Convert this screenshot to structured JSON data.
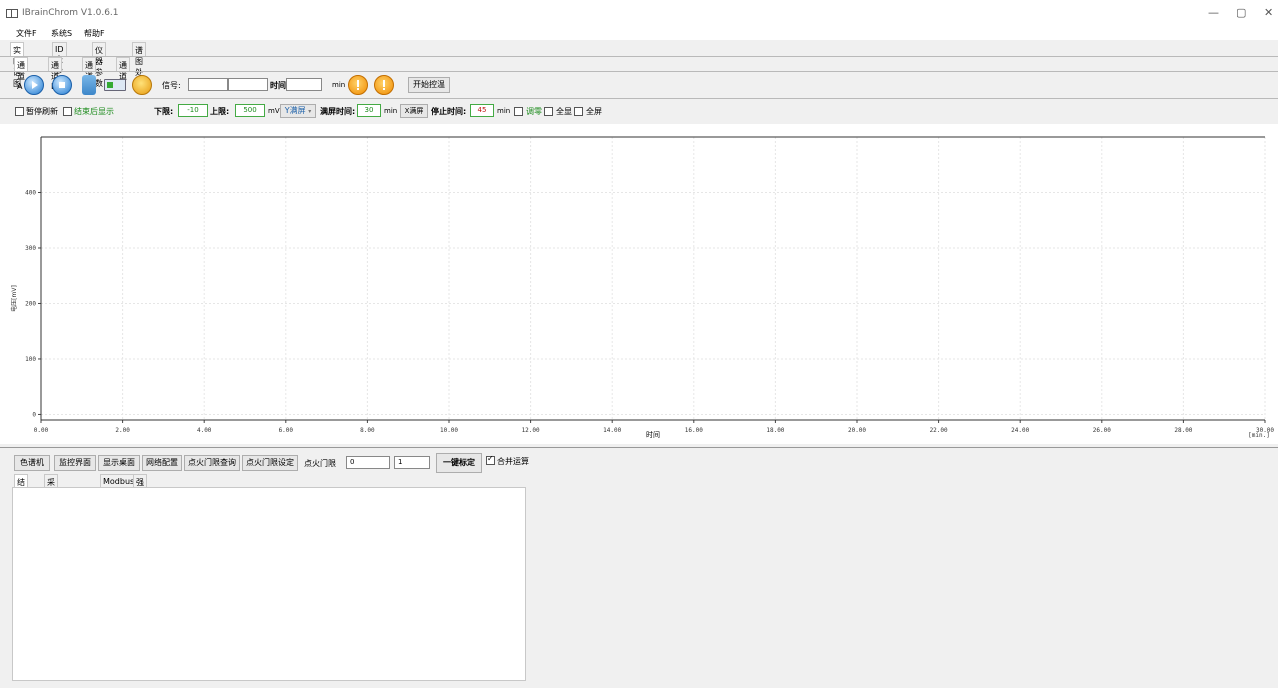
{
  "window": {
    "title": "IBrainChrom  V1.0.6.1",
    "minimize": "—",
    "maximize": "▢",
    "close": "✕"
  },
  "menu": [
    "文件F",
    "系统S",
    "帮助F"
  ],
  "main_tabs": [
    "实时谱图",
    "ID表参数",
    "仪器参数",
    "谱图处理"
  ],
  "channel_tabs": [
    "通道A",
    "通道B",
    "通道C",
    "通道D"
  ],
  "toolbar": {
    "signal_label": "信号:",
    "signal_value": "",
    "signal_value2": "",
    "time_label": "时间",
    "time_value": "",
    "time_unit": "min",
    "start_temp_button": "开始控温"
  },
  "options": {
    "pause_refresh": "暂停刷新",
    "show_after_end": "结束后显示",
    "lower_label": "下限:",
    "lower_value": "-10",
    "upper_label": "上限:",
    "upper_value": "500",
    "mv_unit": "mV",
    "y_fullscreen": "Y满屏",
    "full_time_label": "满屏时间:",
    "full_time_value": "30",
    "full_time_unit": "min",
    "x_fullscreen": "X满屏",
    "stop_time_label": "停止时间:",
    "stop_time_value": "45",
    "stop_time_unit": "min",
    "tune": "调零",
    "show_all": "全显",
    "fullscreen": "全屏"
  },
  "chart_data": {
    "type": "line",
    "xlabel": "时间",
    "ylabel": "电压[mV]",
    "x_unit": "[min.]",
    "xlim": [
      0,
      30
    ],
    "ylim": [
      -10,
      500
    ],
    "x_ticks": [
      "0.00",
      "2.00",
      "4.00",
      "6.00",
      "8.00",
      "10.00",
      "12.00",
      "14.00",
      "16.00",
      "18.00",
      "20.00",
      "22.00",
      "24.00",
      "26.00",
      "28.00",
      "30.00"
    ],
    "y_ticks": [
      "0",
      "100",
      "200",
      "300",
      "400"
    ],
    "grid": true,
    "series": []
  },
  "bottom_buttons": [
    "色谱机",
    "监控界面",
    "显示桌面",
    "网络配置",
    "点火门限查询",
    "点火门限设定"
  ],
  "ignition": {
    "label": "点火门限",
    "value1": "0",
    "value2": "1",
    "calibrate_button": "一键标定",
    "merge_label": "合并运算"
  },
  "bottom_tabs": [
    "结果",
    "采样时序设定",
    "Modbus",
    "强检峰"
  ]
}
